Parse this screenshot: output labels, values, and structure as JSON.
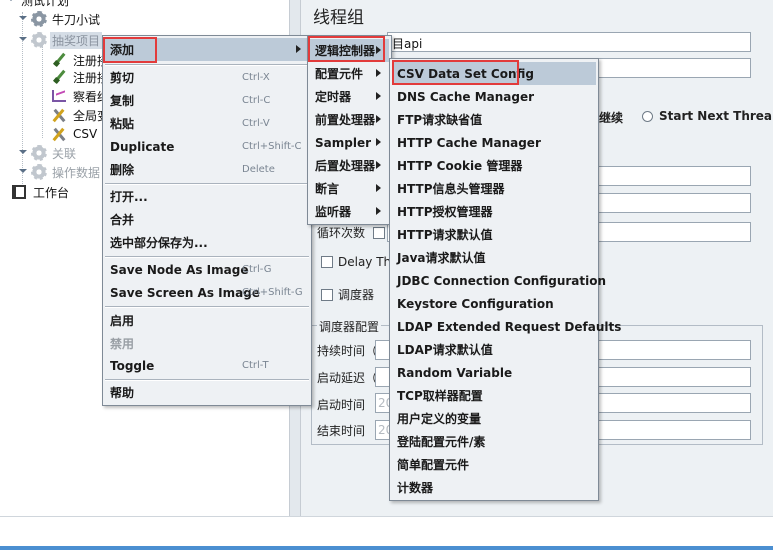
{
  "tree": {
    "top_partial": "测试计划",
    "nodes": [
      {
        "label": "牛刀小试",
        "icon": "gear-icon"
      },
      {
        "label": "抽奖项目",
        "icon": "gear-icon"
      },
      {
        "label": "注册接",
        "icon": "pipette-icon"
      },
      {
        "label": "注册接",
        "icon": "pipette-icon"
      },
      {
        "label": "察看结",
        "icon": "chart-icon"
      },
      {
        "label": "全局变",
        "icon": "wrench-icon"
      },
      {
        "label": "CSV",
        "icon": "wrench-icon"
      },
      {
        "label": "关联",
        "icon": "gear-icon"
      },
      {
        "label": "操作数据",
        "icon": "gear-icon"
      },
      {
        "label": "工作台",
        "icon": "workbench-icon"
      }
    ]
  },
  "panel": {
    "title": "线程组",
    "name_value": "目api",
    "on_error": {
      "continue_label": "继续",
      "start_next_label": "Start Next Threa"
    },
    "loop_label": "循环次数",
    "delay_label": "Delay Thr",
    "scheduler_label": "调度器",
    "scheduler_config_label": "调度器配置",
    "duration_label": "持续时间（秒",
    "startup_delay_label": "启动延迟（秒",
    "start_time_label": "启动时间",
    "end_time_label": "结束时间",
    "start_time_value": "20",
    "end_time_value": "20"
  },
  "context_menu": {
    "items": [
      {
        "label": "添加",
        "shortcut": "",
        "has_submenu": true,
        "highlighted": true
      },
      {
        "label": "剪切",
        "shortcut": "Ctrl-X"
      },
      {
        "label": "复制",
        "shortcut": "Ctrl-C"
      },
      {
        "label": "粘贴",
        "shortcut": "Ctrl-V"
      },
      {
        "label": "Duplicate",
        "shortcut": "Ctrl+Shift-C"
      },
      {
        "label": "删除",
        "shortcut": "Delete"
      },
      {
        "label": "打开..."
      },
      {
        "label": "合并"
      },
      {
        "label": "选中部分保存为..."
      },
      {
        "label": "Save Node As Image",
        "shortcut": "Ctrl-G"
      },
      {
        "label": "Save Screen As Image",
        "shortcut": "Ctrl+Shift-G"
      },
      {
        "label": "启用"
      },
      {
        "label": "禁用",
        "disabled": true
      },
      {
        "label": "Toggle",
        "shortcut": "Ctrl-T"
      },
      {
        "label": "帮助"
      }
    ]
  },
  "add_submenu": {
    "items": [
      {
        "label": "逻辑控制器",
        "highlighted": true
      },
      {
        "label": "配置元件"
      },
      {
        "label": "定时器"
      },
      {
        "label": "前置处理器"
      },
      {
        "label": "Sampler"
      },
      {
        "label": "后置处理器"
      },
      {
        "label": "断言"
      },
      {
        "label": "监听器"
      }
    ]
  },
  "config_submenu": {
    "items": [
      {
        "label": "CSV Data Set Config",
        "highlighted": true
      },
      {
        "label": "DNS Cache Manager"
      },
      {
        "label": "FTP请求缺省值"
      },
      {
        "label": "HTTP Cache Manager"
      },
      {
        "label": "HTTP Cookie 管理器"
      },
      {
        "label": "HTTP信息头管理器"
      },
      {
        "label": "HTTP授权管理器"
      },
      {
        "label": "HTTP请求默认值"
      },
      {
        "label": "Java请求默认值"
      },
      {
        "label": "JDBC Connection Configuration"
      },
      {
        "label": "Keystore Configuration"
      },
      {
        "label": "LDAP Extended Request Defaults"
      },
      {
        "label": "LDAP请求默认值"
      },
      {
        "label": "Random Variable"
      },
      {
        "label": "TCP取样器配置"
      },
      {
        "label": "用户定义的变量"
      },
      {
        "label": "登陆配置元件/素"
      },
      {
        "label": "简单配置元件"
      },
      {
        "label": "计数器"
      }
    ]
  },
  "colors": {
    "highlight": "#bccad8",
    "annotation": "#e23b3b",
    "accent_bar": "#4b8fd1"
  }
}
